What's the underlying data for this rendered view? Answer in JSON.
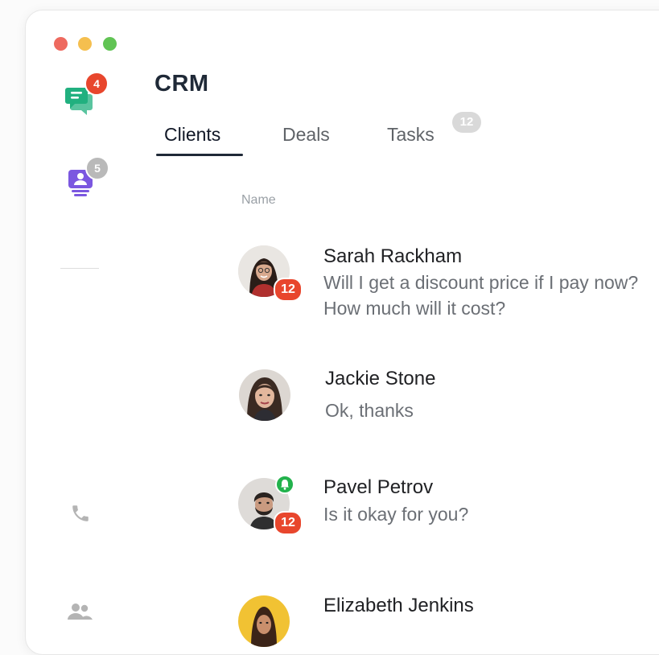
{
  "window": {
    "traffic_lights": [
      "close",
      "minimize",
      "maximize"
    ]
  },
  "sidebar": {
    "chat_badge": "4",
    "contacts_badge": "5",
    "colors": {
      "chat": "#21b07f",
      "contacts": "#7b57e0",
      "badge_red": "#e8462d",
      "badge_gray": "#b9b9b9"
    },
    "icons": [
      "chat-bubbles-icon",
      "contacts-icon",
      "phone-icon",
      "people-icon"
    ]
  },
  "header": {
    "title": "CRM"
  },
  "tabs": [
    {
      "label": "Clients",
      "active": true
    },
    {
      "label": "Deals",
      "active": false
    },
    {
      "label": "Tasks",
      "active": false,
      "count": "12"
    }
  ],
  "table": {
    "column_header": "Name",
    "rows": [
      {
        "name": "Sarah Rackham",
        "message": "Will I get a discount price if I pay now? How much will it cost?",
        "unread": "12"
      },
      {
        "name": "Jackie Stone",
        "message": "Ok, thanks"
      },
      {
        "name": "Pavel Petrov",
        "message": "Is it okay for you?",
        "unread": "12",
        "notification": "bell"
      },
      {
        "name": "Elizabeth Jenkins",
        "message": ""
      }
    ]
  }
}
